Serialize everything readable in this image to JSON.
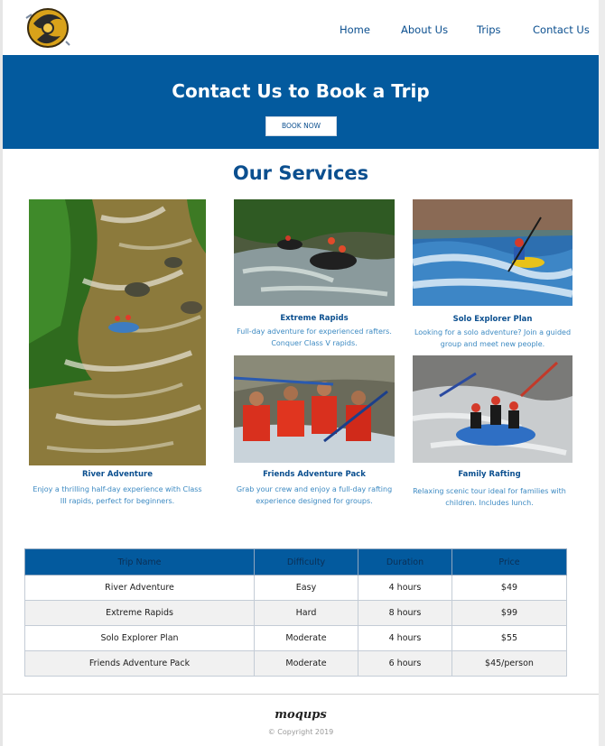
{
  "nav": {
    "home": "Home",
    "about": "About Us",
    "trips": "Trips",
    "contact": "Contact Us"
  },
  "hero": {
    "title": "Contact Us to Book a Trip",
    "button": "BOOK NOW"
  },
  "services": {
    "title": "Our Services",
    "items": [
      {
        "title": "River Adventure",
        "desc": "Enjoy a thrilling half-day experience with Class III rapids, perfect for beginners."
      },
      {
        "title": "Extreme Rapids",
        "desc": "Full-day adventure for experienced rafters. Conquer Class V rapids."
      },
      {
        "title": "Solo Explorer Plan",
        "desc": "Looking for a solo adventure? Join a guided group and meet new people."
      },
      {
        "title": "Friends Adventure Pack",
        "desc": "Grab your crew and enjoy a full-day rafting experience designed for groups."
      },
      {
        "title": "Family Rafting",
        "desc": "Relaxing scenic tour ideal for families with children. Includes lunch."
      }
    ]
  },
  "table": {
    "headers": [
      "Trip Name",
      "Difficulty",
      "Duration",
      "Price"
    ],
    "rows": [
      [
        "River Adventure",
        "Easy",
        "4 hours",
        "$49"
      ],
      [
        "Extreme Rapids",
        "Hard",
        "8 hours",
        "$99"
      ],
      [
        "Solo Explorer Plan",
        "Moderate",
        "4 hours",
        "$55"
      ],
      [
        "Friends Adventure Pack",
        "Moderate",
        "6 hours",
        "$45/person"
      ]
    ]
  },
  "footer": {
    "logo": "moqups",
    "copyright": "© Copyright 2019"
  },
  "colors": {
    "brand_blue": "#035a9e",
    "text_blue": "#0b4f8f",
    "caption_blue": "#3d8ac2"
  }
}
